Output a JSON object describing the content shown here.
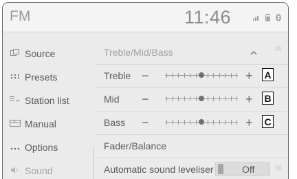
{
  "topbar": {
    "source": "FM",
    "time": "11:46",
    "status_icons": [
      "signal-icon",
      "phone-battery-icon",
      "bluetooth-icon"
    ]
  },
  "sidebar": {
    "items": [
      {
        "label": "Source",
        "icon": "source-icon"
      },
      {
        "label": "Presets",
        "icon": "presets-icon"
      },
      {
        "label": "Station list",
        "icon": "station-list-icon"
      },
      {
        "label": "Manual",
        "icon": "manual-icon"
      },
      {
        "label": "Options",
        "icon": "options-icon"
      },
      {
        "label": "Sound",
        "icon": "sound-icon"
      }
    ]
  },
  "main": {
    "section_title": "Treble/Mid/Bass",
    "sliders": [
      {
        "label": "Treble",
        "level": 0,
        "callout": "A"
      },
      {
        "label": "Mid",
        "level": 0,
        "callout": "B"
      },
      {
        "label": "Bass",
        "level": 0,
        "callout": "C"
      }
    ],
    "fader_label": "Fader/Balance",
    "leveller_label": "Automatic sound leveliser",
    "leveller_value": "Off"
  }
}
